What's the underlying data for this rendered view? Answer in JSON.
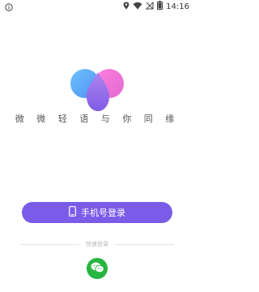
{
  "status_bar": {
    "time": "14:16",
    "icons": [
      "info-icon",
      "location-icon",
      "wifi-icon",
      "signal-off-icon",
      "battery-icon"
    ]
  },
  "app": {
    "slogan": "微 微 轻 语   与 你 同 缘",
    "logo_colors": {
      "blue": "#5aa7f5",
      "pink": "#f36fd4",
      "purple": "#9a6bea"
    }
  },
  "login": {
    "phone_login_label": "手机号登录",
    "phone_icon": "phone-icon",
    "accent_color": "#7b5ce8",
    "quick_login_label": "快速登录",
    "wechat_icon": "wechat-icon",
    "wechat_color": "#26b540"
  }
}
